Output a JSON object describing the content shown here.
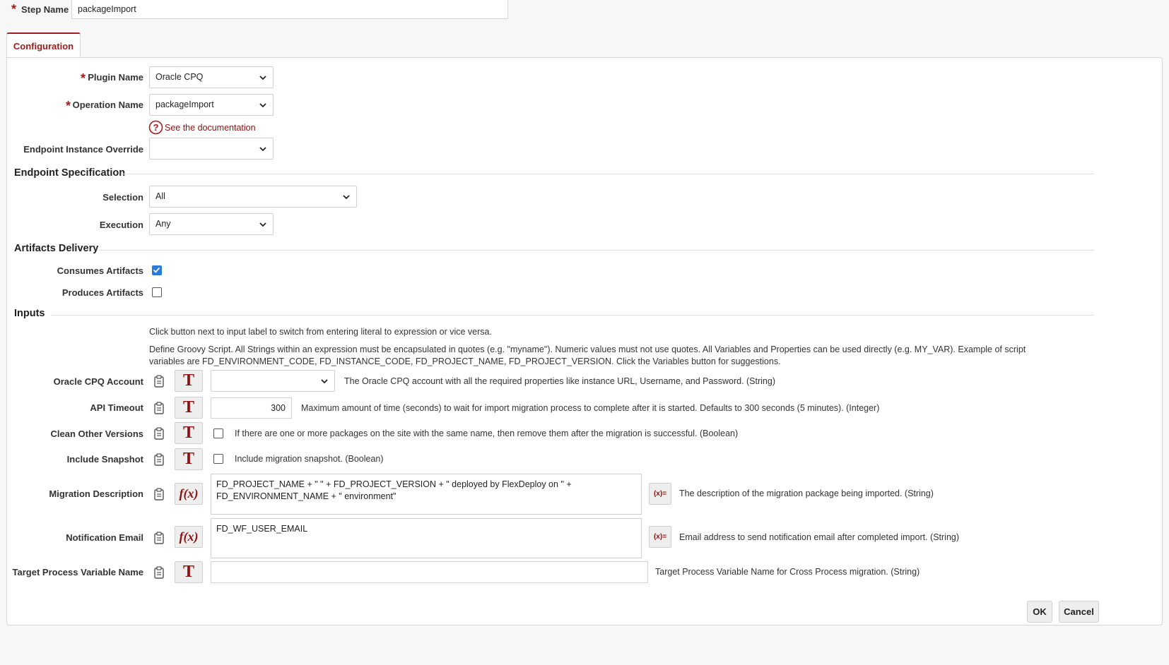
{
  "step": {
    "label": "Step Name",
    "value": "packageImport"
  },
  "tabs": [
    "Configuration"
  ],
  "config": {
    "plugin_label": "Plugin Name",
    "plugin_value": "Oracle CPQ",
    "operation_label": "Operation Name",
    "operation_value": "packageImport",
    "doc_link": "See the documentation",
    "endpoint_override_label": "Endpoint Instance Override",
    "endpoint_override_value": ""
  },
  "endpoint_spec": {
    "title": "Endpoint Specification",
    "selection_label": "Selection",
    "selection_value": "All",
    "execution_label": "Execution",
    "execution_value": "Any"
  },
  "artifacts": {
    "title": "Artifacts Delivery",
    "consumes_label": "Consumes Artifacts",
    "consumes_checked": true,
    "produces_label": "Produces Artifacts",
    "produces_checked": false
  },
  "inputs": {
    "title": "Inputs",
    "help1": "Click button next to input label to switch from entering literal to expression or vice versa.",
    "help2": "Define Groovy Script. All Strings within an expression must be encapsulated in quotes (e.g. \"myname\"). Numeric values must not use quotes. All Variables and Properties can be used directly (e.g. MY_VAR). Example of script variables are FD_ENVIRONMENT_CODE, FD_INSTANCE_CODE, FD_PROJECT_NAME, FD_PROJECT_VERSION. Click the Variables button for suggestions.",
    "toggle_literal": "T",
    "toggle_expression": "f(x)",
    "variables_button": "(x)=",
    "account": {
      "label": "Oracle CPQ Account",
      "value": "",
      "description": "The Oracle CPQ account with all the required properties like instance URL, Username, and Password. (String)"
    },
    "timeout": {
      "label": "API Timeout",
      "value": "300",
      "description": "Maximum amount of time (seconds) to wait for import migration process to complete after it is started. Defaults to 300 seconds (5 minutes). (Integer)"
    },
    "clean": {
      "label": "Clean Other Versions",
      "checked": false,
      "description": "If there are one or more packages on the site with the same name, then remove them after the migration is successful. (Boolean)"
    },
    "snapshot": {
      "label": "Include Snapshot",
      "checked": false,
      "description": "Include migration snapshot. (Boolean)"
    },
    "migration_desc": {
      "label": "Migration Description",
      "value": "FD_PROJECT_NAME + \" \" + FD_PROJECT_VERSION + \" deployed by FlexDeploy on \" + FD_ENVIRONMENT_NAME + \" environment\"",
      "description": "The description of the migration package being imported. (String)"
    },
    "email": {
      "label": "Notification Email",
      "value": "FD_WF_USER_EMAIL",
      "description": "Email address to send notification email after completed import. (String)"
    },
    "target_var": {
      "label": "Target Process Variable Name",
      "value": "",
      "description": "Target Process Variable Name for Cross Process migration. (String)"
    }
  },
  "footer": {
    "ok": "OK",
    "cancel": "Cancel"
  },
  "colors": {
    "accent": "#a01d1d",
    "checkbox_on": "#2a7ad8"
  }
}
